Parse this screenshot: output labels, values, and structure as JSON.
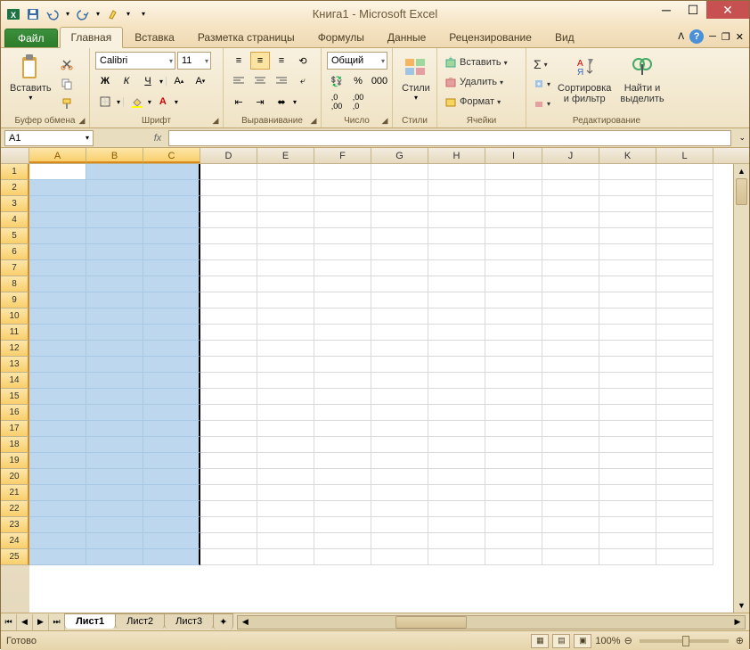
{
  "title": "Книга1 - Microsoft Excel",
  "qat": {
    "save": "save",
    "undo": "undo",
    "redo": "redo"
  },
  "file_tab": "Файл",
  "tabs": [
    "Главная",
    "Вставка",
    "Разметка страницы",
    "Формулы",
    "Данные",
    "Рецензирование",
    "Вид"
  ],
  "active_tab": 0,
  "ribbon": {
    "clipboard": {
      "label": "Буфер обмена",
      "paste": "Вставить"
    },
    "font": {
      "label": "Шрифт",
      "name": "Calibri",
      "size": "11",
      "bold": "Ж",
      "italic": "К",
      "underline": "Ч"
    },
    "alignment": {
      "label": "Выравнивание"
    },
    "number": {
      "label": "Число",
      "format": "Общий"
    },
    "styles": {
      "label": "Стили",
      "btn": "Стили"
    },
    "cells": {
      "label": "Ячейки",
      "insert": "Вставить",
      "delete": "Удалить",
      "format": "Формат"
    },
    "editing": {
      "label": "Редактирование",
      "sort": "Сортировка\nи фильтр",
      "find": "Найти и\nвыделить"
    }
  },
  "name_box": "A1",
  "fx": "fx",
  "columns": [
    "A",
    "B",
    "C",
    "D",
    "E",
    "F",
    "G",
    "H",
    "I",
    "J",
    "K",
    "L"
  ],
  "selected_cols": [
    "A",
    "B",
    "C"
  ],
  "rows": [
    1,
    2,
    3,
    4,
    5,
    6,
    7,
    8,
    9,
    10,
    11,
    12,
    13,
    14,
    15,
    16,
    17,
    18,
    19,
    20,
    21,
    22,
    23,
    24,
    25
  ],
  "active_cell": "A1",
  "sheets": [
    "Лист1",
    "Лист2",
    "Лист3"
  ],
  "active_sheet": 0,
  "status": "Готово",
  "zoom": "100%"
}
